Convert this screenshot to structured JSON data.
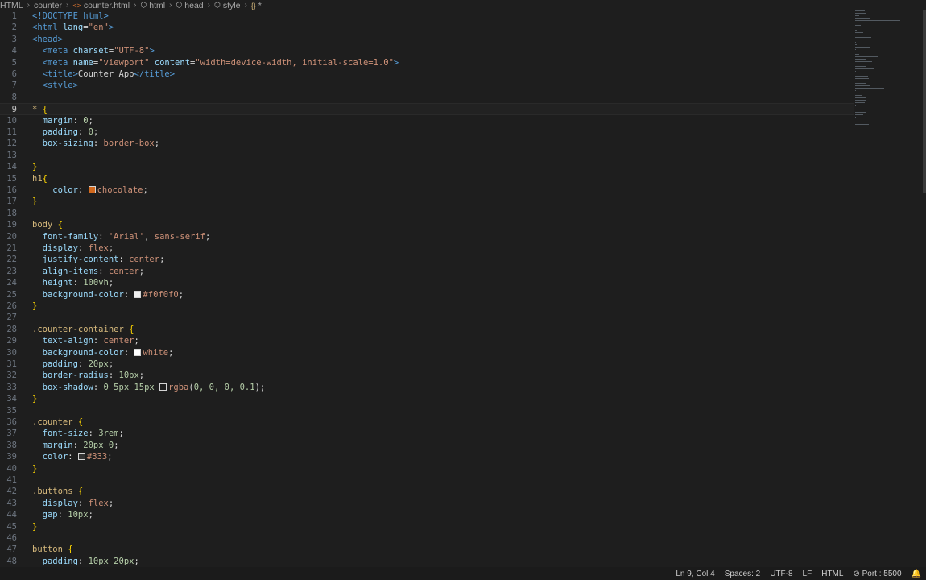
{
  "breadcrumb": {
    "items": [
      "HTML",
      "counter",
      "counter.html",
      "html",
      "head",
      "style",
      "*"
    ]
  },
  "code": {
    "current_line": 9,
    "lines": [
      [
        [
          "t-tag",
          "<!DOCTYPE html>"
        ]
      ],
      [
        [
          "t-tag",
          "<html "
        ],
        [
          "t-attr",
          "lang"
        ],
        [
          "t-plain",
          "="
        ],
        [
          "t-str",
          "\"en\""
        ],
        [
          "t-tag",
          ">"
        ]
      ],
      [
        [
          "t-tag",
          "<head>"
        ]
      ],
      [
        [
          "t-plain",
          "  "
        ],
        [
          "t-tag",
          "<meta "
        ],
        [
          "t-attr",
          "charset"
        ],
        [
          "t-plain",
          "="
        ],
        [
          "t-str",
          "\"UTF-8\""
        ],
        [
          "t-tag",
          ">"
        ]
      ],
      [
        [
          "t-plain",
          "  "
        ],
        [
          "t-tag",
          "<meta "
        ],
        [
          "t-attr",
          "name"
        ],
        [
          "t-plain",
          "="
        ],
        [
          "t-str",
          "\"viewport\""
        ],
        [
          "t-plain",
          " "
        ],
        [
          "t-attr",
          "content"
        ],
        [
          "t-plain",
          "="
        ],
        [
          "t-str",
          "\"width=device-width, initial-scale=1.0\""
        ],
        [
          "t-tag",
          ">"
        ]
      ],
      [
        [
          "t-plain",
          "  "
        ],
        [
          "t-tag",
          "<title>"
        ],
        [
          "t-text",
          "Counter App"
        ],
        [
          "t-tag",
          "</title>"
        ]
      ],
      [
        [
          "t-plain",
          "  "
        ],
        [
          "t-tag",
          "<style>"
        ]
      ],
      [],
      [
        [
          "t-sel",
          "* "
        ],
        [
          "t-brace",
          "{"
        ]
      ],
      [
        [
          "t-plain",
          "  "
        ],
        [
          "t-prop",
          "margin"
        ],
        [
          "t-plain",
          ": "
        ],
        [
          "t-num",
          "0"
        ],
        [
          "t-plain",
          ";"
        ]
      ],
      [
        [
          "t-plain",
          "  "
        ],
        [
          "t-prop",
          "padding"
        ],
        [
          "t-plain",
          ": "
        ],
        [
          "t-num",
          "0"
        ],
        [
          "t-plain",
          ";"
        ]
      ],
      [
        [
          "t-plain",
          "  "
        ],
        [
          "t-prop",
          "box-sizing"
        ],
        [
          "t-plain",
          ": "
        ],
        [
          "t-val",
          "border-box"
        ],
        [
          "t-plain",
          ";"
        ]
      ],
      [],
      [
        [
          "t-brace",
          "}"
        ]
      ],
      [
        [
          "t-sel",
          "h1"
        ],
        [
          "t-brace",
          "{"
        ]
      ],
      [
        [
          "t-plain",
          "    "
        ],
        [
          "t-prop",
          "color"
        ],
        [
          "t-plain",
          ": "
        ],
        [
          "swatch",
          "#d2691e"
        ],
        [
          "t-val",
          "chocolate"
        ],
        [
          "t-plain",
          ";"
        ]
      ],
      [
        [
          "t-brace",
          "}"
        ]
      ],
      [],
      [
        [
          "t-sel",
          "body "
        ],
        [
          "t-brace",
          "{"
        ]
      ],
      [
        [
          "t-plain",
          "  "
        ],
        [
          "t-prop",
          "font-family"
        ],
        [
          "t-plain",
          ": "
        ],
        [
          "t-str",
          "'Arial'"
        ],
        [
          "t-plain",
          ", "
        ],
        [
          "t-val",
          "sans-serif"
        ],
        [
          "t-plain",
          ";"
        ]
      ],
      [
        [
          "t-plain",
          "  "
        ],
        [
          "t-prop",
          "display"
        ],
        [
          "t-plain",
          ": "
        ],
        [
          "t-val",
          "flex"
        ],
        [
          "t-plain",
          ";"
        ]
      ],
      [
        [
          "t-plain",
          "  "
        ],
        [
          "t-prop",
          "justify-content"
        ],
        [
          "t-plain",
          ": "
        ],
        [
          "t-val",
          "center"
        ],
        [
          "t-plain",
          ";"
        ]
      ],
      [
        [
          "t-plain",
          "  "
        ],
        [
          "t-prop",
          "align-items"
        ],
        [
          "t-plain",
          ": "
        ],
        [
          "t-val",
          "center"
        ],
        [
          "t-plain",
          ";"
        ]
      ],
      [
        [
          "t-plain",
          "  "
        ],
        [
          "t-prop",
          "height"
        ],
        [
          "t-plain",
          ": "
        ],
        [
          "t-num",
          "100vh"
        ],
        [
          "t-plain",
          ";"
        ]
      ],
      [
        [
          "t-plain",
          "  "
        ],
        [
          "t-prop",
          "background-color"
        ],
        [
          "t-plain",
          ": "
        ],
        [
          "swatch",
          "#f0f0f0"
        ],
        [
          "t-val",
          "#f0f0f0"
        ],
        [
          "t-plain",
          ";"
        ]
      ],
      [
        [
          "t-brace",
          "}"
        ]
      ],
      [],
      [
        [
          "t-sel",
          ".counter-container "
        ],
        [
          "t-brace",
          "{"
        ]
      ],
      [
        [
          "t-plain",
          "  "
        ],
        [
          "t-prop",
          "text-align"
        ],
        [
          "t-plain",
          ": "
        ],
        [
          "t-val",
          "center"
        ],
        [
          "t-plain",
          ";"
        ]
      ],
      [
        [
          "t-plain",
          "  "
        ],
        [
          "t-prop",
          "background-color"
        ],
        [
          "t-plain",
          ": "
        ],
        [
          "swatch",
          "#ffffff"
        ],
        [
          "t-val",
          "white"
        ],
        [
          "t-plain",
          ";"
        ]
      ],
      [
        [
          "t-plain",
          "  "
        ],
        [
          "t-prop",
          "padding"
        ],
        [
          "t-plain",
          ": "
        ],
        [
          "t-num",
          "20px"
        ],
        [
          "t-plain",
          ";"
        ]
      ],
      [
        [
          "t-plain",
          "  "
        ],
        [
          "t-prop",
          "border-radius"
        ],
        [
          "t-plain",
          ": "
        ],
        [
          "t-num",
          "10px"
        ],
        [
          "t-plain",
          ";"
        ]
      ],
      [
        [
          "t-plain",
          "  "
        ],
        [
          "t-prop",
          "box-shadow"
        ],
        [
          "t-plain",
          ": "
        ],
        [
          "t-num",
          "0 5px 15px "
        ],
        [
          "swatch",
          "#1e1e1e"
        ],
        [
          "t-val",
          "rgba"
        ],
        [
          "t-plain",
          "("
        ],
        [
          "t-num",
          "0, 0, 0, 0.1"
        ],
        [
          "t-plain",
          ");"
        ]
      ],
      [
        [
          "t-brace",
          "}"
        ]
      ],
      [],
      [
        [
          "t-sel",
          ".counter "
        ],
        [
          "t-brace",
          "{"
        ]
      ],
      [
        [
          "t-plain",
          "  "
        ],
        [
          "t-prop",
          "font-size"
        ],
        [
          "t-plain",
          ": "
        ],
        [
          "t-num",
          "3rem"
        ],
        [
          "t-plain",
          ";"
        ]
      ],
      [
        [
          "t-plain",
          "  "
        ],
        [
          "t-prop",
          "margin"
        ],
        [
          "t-plain",
          ": "
        ],
        [
          "t-num",
          "20px 0"
        ],
        [
          "t-plain",
          ";"
        ]
      ],
      [
        [
          "t-plain",
          "  "
        ],
        [
          "t-prop",
          "color"
        ],
        [
          "t-plain",
          ": "
        ],
        [
          "swatch",
          "#333333"
        ],
        [
          "t-val",
          "#333"
        ],
        [
          "t-plain",
          ";"
        ]
      ],
      [
        [
          "t-brace",
          "}"
        ]
      ],
      [],
      [
        [
          "t-sel",
          ".buttons "
        ],
        [
          "t-brace",
          "{"
        ]
      ],
      [
        [
          "t-plain",
          "  "
        ],
        [
          "t-prop",
          "display"
        ],
        [
          "t-plain",
          ": "
        ],
        [
          "t-val",
          "flex"
        ],
        [
          "t-plain",
          ";"
        ]
      ],
      [
        [
          "t-plain",
          "  "
        ],
        [
          "t-prop",
          "gap"
        ],
        [
          "t-plain",
          ": "
        ],
        [
          "t-num",
          "10px"
        ],
        [
          "t-plain",
          ";"
        ]
      ],
      [
        [
          "t-brace",
          "}"
        ]
      ],
      [],
      [
        [
          "t-sel",
          "button "
        ],
        [
          "t-brace",
          "{"
        ]
      ],
      [
        [
          "t-plain",
          "  "
        ],
        [
          "t-prop",
          "padding"
        ],
        [
          "t-plain",
          ": "
        ],
        [
          "t-num",
          "10px 20px"
        ],
        [
          "t-plain",
          ";"
        ]
      ]
    ]
  },
  "statusbar": {
    "position": "Ln 9, Col 4",
    "spaces": "Spaces: 2",
    "encoding": "UTF-8",
    "eol": "LF",
    "language": "HTML",
    "port": "Port : 5500"
  }
}
